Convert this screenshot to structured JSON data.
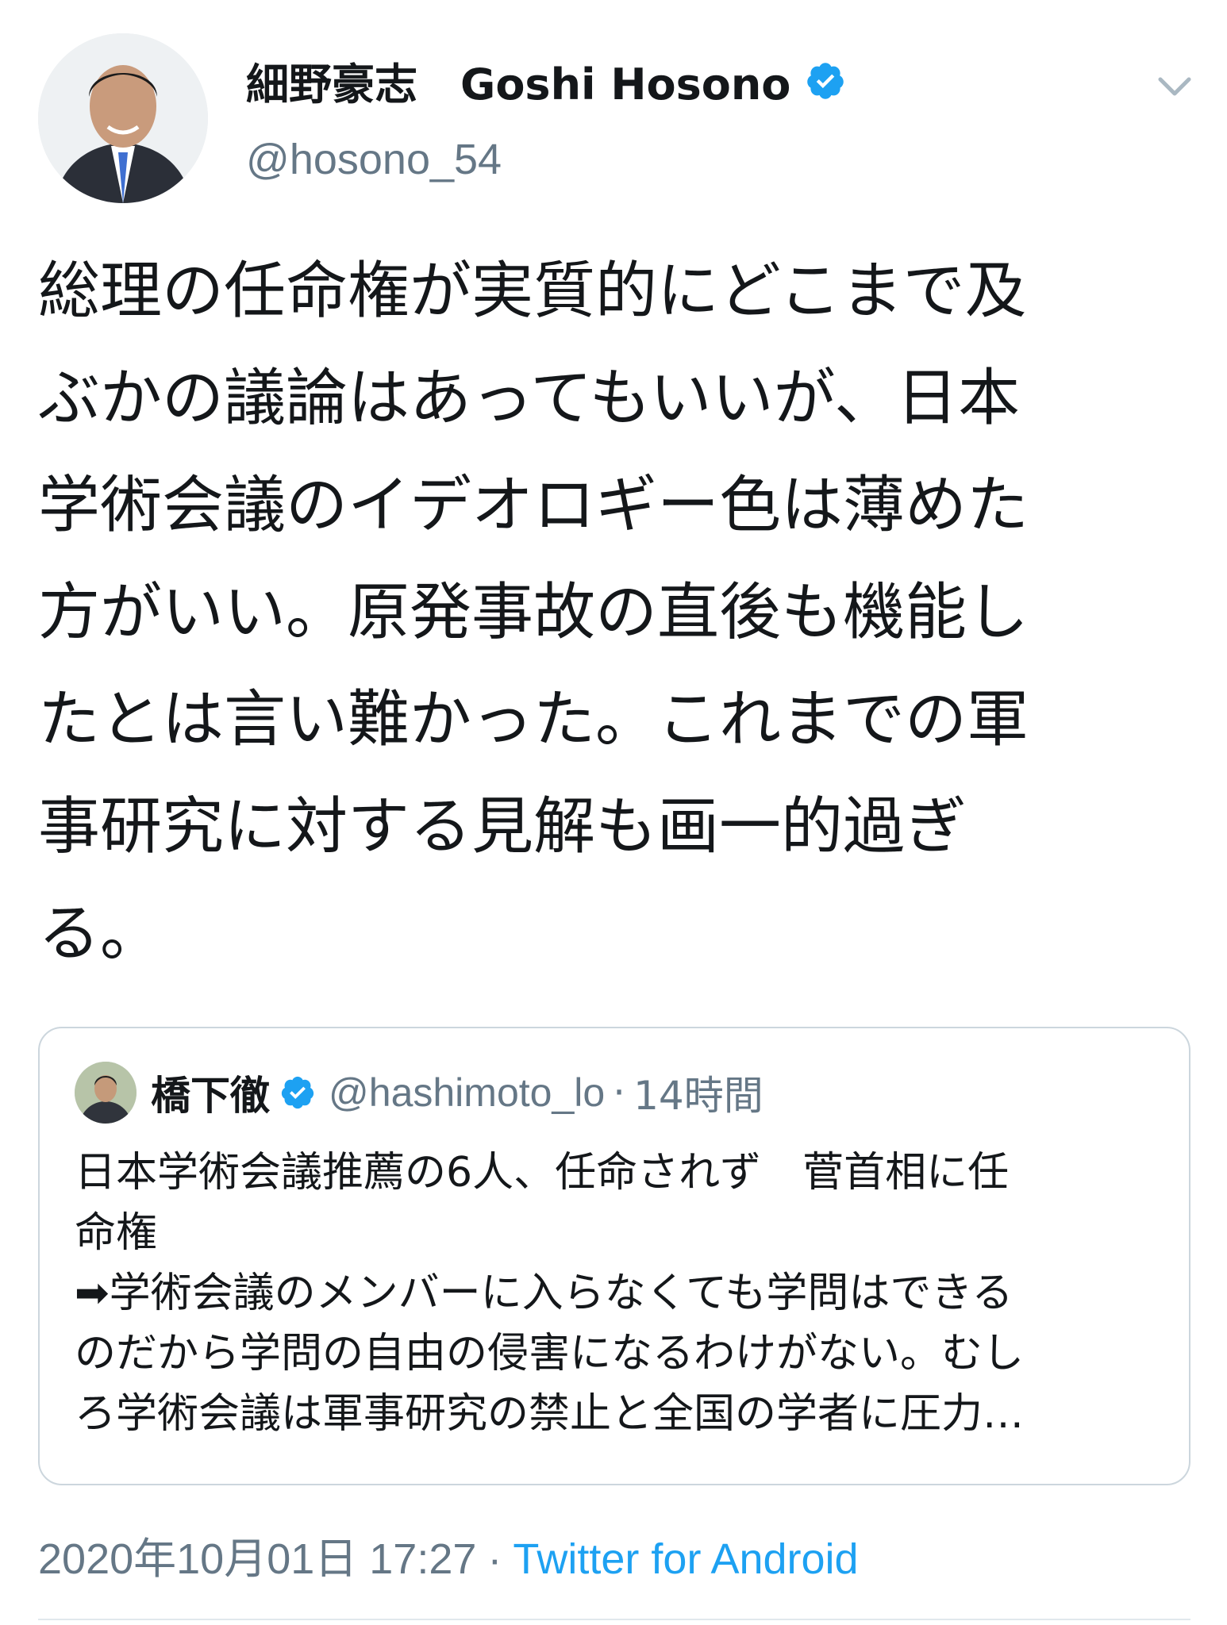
{
  "author": {
    "display_name": "細野豪志　Goshi Hosono",
    "handle": "@hosono_54",
    "verified": true
  },
  "tweet": {
    "text_lines": [
      "総理の任命権が実質的にどこまで及",
      "ぶかの議論はあってもいいが、日本",
      "学術会議のイデオロギー色は薄めた",
      "方がいい。原発事故の直後も機能し",
      "たとは言い難かった。これまでの軍",
      "事研究に対する見解も画一的過ぎ",
      "る。"
    ]
  },
  "quoted_tweet": {
    "display_name": "橋下徹",
    "handle": "@hashimoto_lo",
    "separator": "·",
    "time": "14時間",
    "verified": true,
    "text_lines": [
      "日本学術会議推薦の6人、任命されず　菅首相に任",
      "命権",
      "➡学術会議のメンバーに入らなくても学問はできる",
      "のだから学問の自由の侵害になるわけがない。むし",
      "ろ学術会議は軍事研究の禁止と全国の学者に圧力…"
    ]
  },
  "meta": {
    "timestamp": "2020年10月01日 17:27",
    "separator": "·",
    "source": "Twitter for Android"
  },
  "colors": {
    "text": "#14171a",
    "secondary": "#657786",
    "accent": "#1da1f2",
    "border": "#ccd6dd"
  },
  "icons": {
    "verified": "verified-badge-icon",
    "caret": "chevron-down-icon"
  }
}
